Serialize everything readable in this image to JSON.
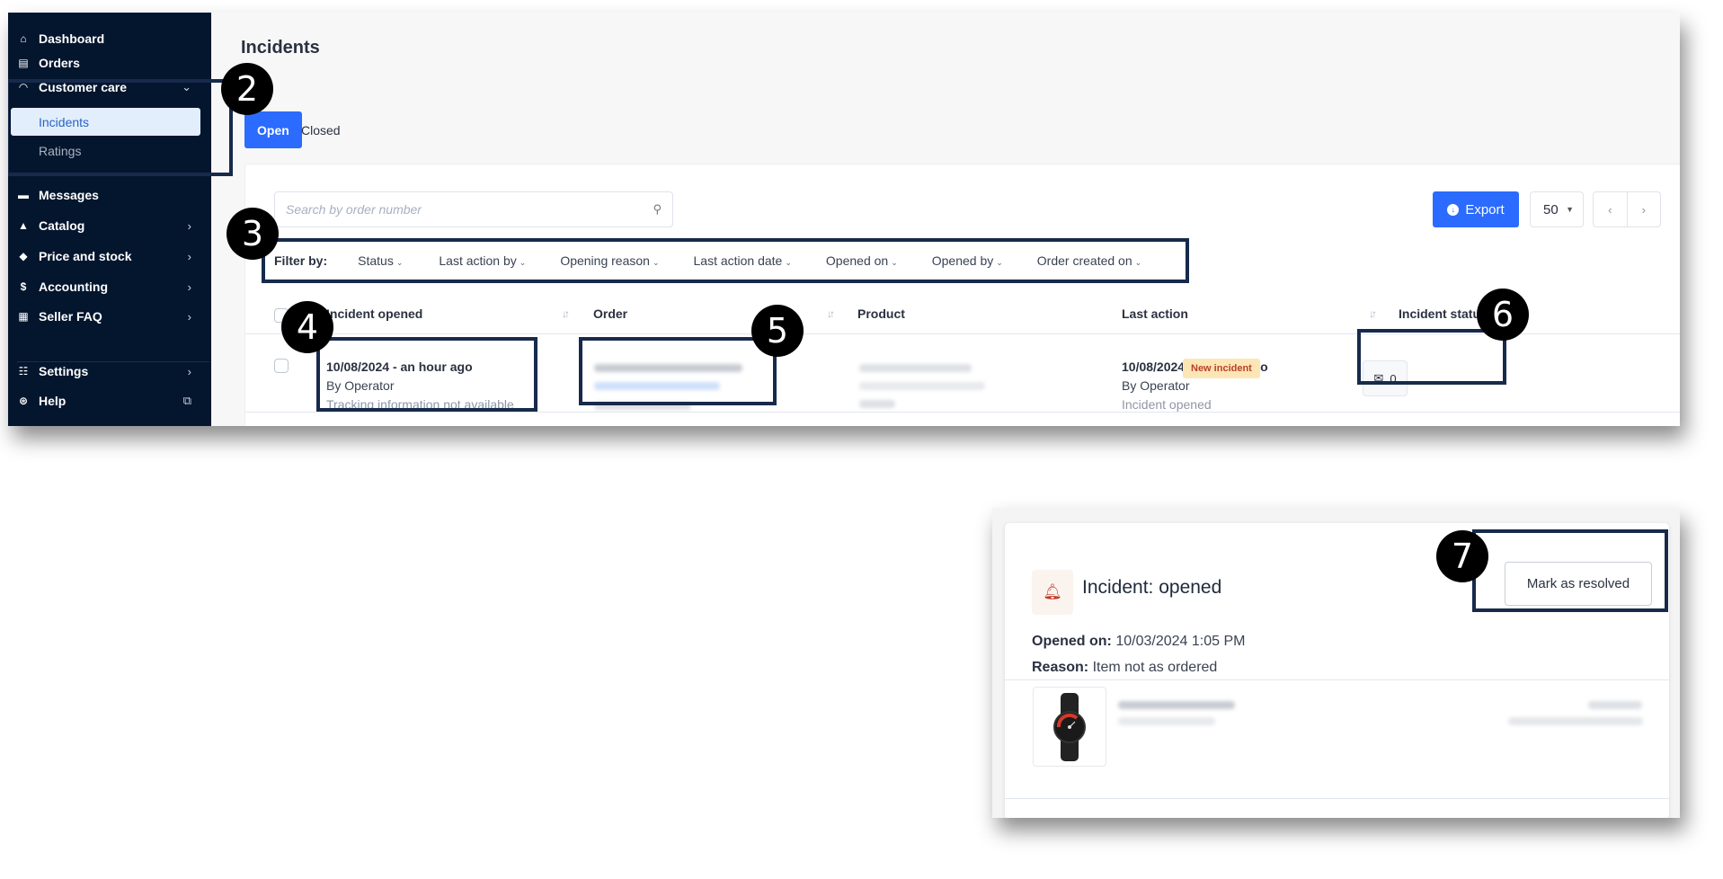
{
  "sidebar": {
    "items": [
      {
        "label": "Dashboard",
        "icon": "home-icon",
        "chevron": ""
      },
      {
        "label": "Orders",
        "icon": "clipboard-icon",
        "chevron": ""
      },
      {
        "label": "Customer care",
        "icon": "headset-icon",
        "chevron": "⌄"
      },
      {
        "label": "Messages",
        "icon": "message-icon",
        "chevron": ""
      },
      {
        "label": "Catalog",
        "icon": "shapes-icon",
        "chevron": "›"
      },
      {
        "label": "Price and stock",
        "icon": "tag-icon",
        "chevron": "›"
      },
      {
        "label": "Accounting",
        "icon": "invoice-icon",
        "chevron": "›"
      },
      {
        "label": "Seller FAQ",
        "icon": "grid-icon",
        "chevron": "›"
      },
      {
        "label": "Settings",
        "icon": "sliders-icon",
        "chevron": "›"
      },
      {
        "label": "Help",
        "icon": "lifebuoy-icon",
        "chevron": "⧉"
      }
    ],
    "sub_items": [
      {
        "label": "Incidents",
        "active": true
      },
      {
        "label": "Ratings",
        "active": false
      }
    ]
  },
  "page": {
    "title": "Incidents",
    "tabs": [
      {
        "label": "Open",
        "active": true
      },
      {
        "label": "Closed",
        "active": false
      }
    ]
  },
  "toolbar": {
    "search_placeholder": "Search by order number",
    "export_label": "Export",
    "per_page": "50",
    "prev": "‹",
    "next": "›"
  },
  "filters": {
    "label": "Filter by:",
    "items": [
      "Status",
      "Last action by",
      "Opening reason",
      "Last action date",
      "Opened on",
      "Opened by",
      "Order created on"
    ]
  },
  "table": {
    "columns": [
      "Incident opened",
      "Order",
      "Product",
      "Last action",
      "Incident status"
    ],
    "rows": [
      {
        "incident_opened": {
          "date": "10/08/2024 - an hour ago",
          "by": "By Operator",
          "reason": "Tracking information not available"
        },
        "order": "[blurred]",
        "product": "[blurred]",
        "last_action": {
          "date": "10/08/2024 - an hour ago",
          "by": "By Operator",
          "action": "Incident opened"
        },
        "status": "New incident",
        "messages": "0"
      }
    ]
  },
  "incident_detail": {
    "title": "Incident: opened",
    "resolve_label": "Mark as resolved",
    "opened_on_label": "Opened on:",
    "opened_on_value": "10/03/2024 1:05 PM",
    "reason_label": "Reason:",
    "reason_value": "Item not as ordered",
    "product_image": "smartwatch"
  },
  "annotations": [
    "2",
    "3",
    "4",
    "5",
    "6",
    "7"
  ],
  "colors": {
    "sidebar_bg": "#04162e",
    "accent": "#2b6bff",
    "status_badge_bg": "#fde6b5",
    "status_badge_text": "#b8402a",
    "annotation_border": "#172a4b"
  }
}
